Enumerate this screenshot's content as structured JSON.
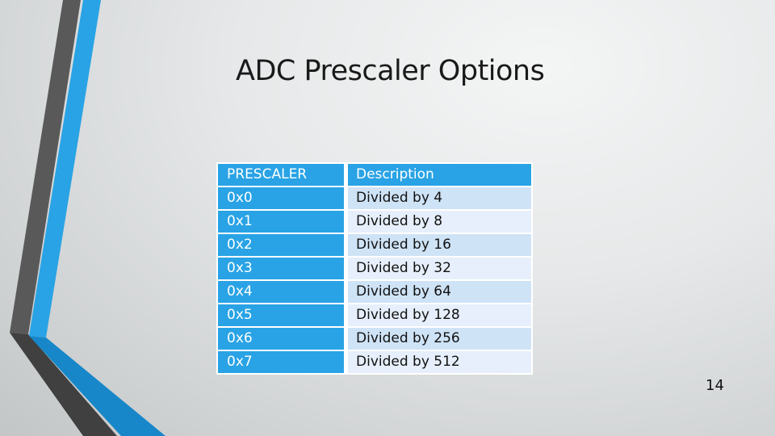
{
  "slide": {
    "title": "ADC Prescaler Options",
    "page_number": "14"
  },
  "table": {
    "headers": [
      "PRESCALER",
      "Description"
    ],
    "rows": [
      [
        "0x0",
        "Divided by 4"
      ],
      [
        "0x1",
        "Divided by 8"
      ],
      [
        "0x2",
        "Divided by 16"
      ],
      [
        "0x3",
        "Divided by 32"
      ],
      [
        "0x4",
        "Divided by 64"
      ],
      [
        "0x5",
        "Divided by 128"
      ],
      [
        "0x6",
        "Divided by 256"
      ],
      [
        "0x7",
        "Divided by 512"
      ]
    ]
  },
  "colors": {
    "accent_blue": "#29a3e5",
    "accent_blue_dark": "#1787c9",
    "stripe_gray": "#595959",
    "stripe_gray_dark": "#404040",
    "row_band_1": "#cfe3f6",
    "row_band_2": "#e6effb"
  }
}
